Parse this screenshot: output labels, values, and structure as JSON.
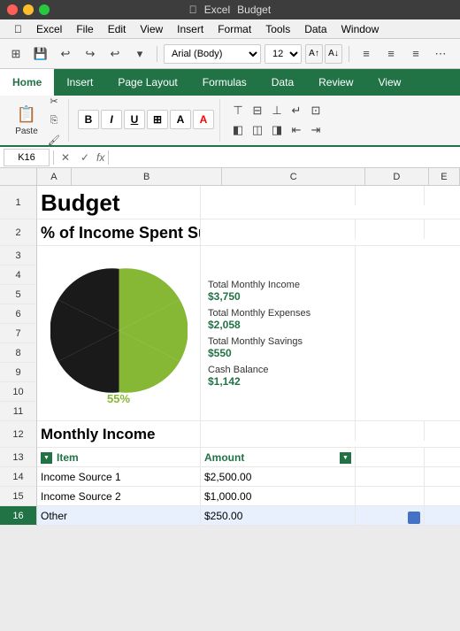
{
  "titleBar": {
    "appName": "Excel",
    "fileName": "Budget"
  },
  "menuBar": {
    "items": [
      "Apple",
      "Excel",
      "File",
      "Edit",
      "View",
      "Insert",
      "Format",
      "Tools",
      "Data",
      "Window"
    ]
  },
  "ribbon": {
    "tabs": [
      "Home",
      "Insert",
      "Page Layout",
      "Formulas",
      "Data",
      "Review",
      "View"
    ],
    "activeTab": "Home"
  },
  "formulaBar": {
    "cellRef": "K16",
    "formula": ""
  },
  "columnHeaders": [
    "A",
    "B",
    "C",
    "D",
    "E"
  ],
  "rows": {
    "r1": {
      "rowNum": "1",
      "b": "Budget"
    },
    "r2": {
      "rowNum": "2",
      "b": "% of Income Spent Summary"
    },
    "r3": {
      "rowNum": "3"
    },
    "r4": {
      "rowNum": "4"
    },
    "r5": {
      "rowNum": "5"
    },
    "r6": {
      "rowNum": "6"
    },
    "r7": {
      "rowNum": "7"
    },
    "r8": {
      "rowNum": "8"
    },
    "r9": {
      "rowNum": "9"
    },
    "r10": {
      "rowNum": "10"
    },
    "r11": {
      "rowNum": "11"
    },
    "r12": {
      "rowNum": "12",
      "b": "Monthly Income"
    },
    "r13": {
      "rowNum": "13",
      "b": "Item",
      "c": "Amount"
    },
    "r14": {
      "rowNum": "14",
      "b": "Income Source 1",
      "c": "$2,500.00"
    },
    "r15": {
      "rowNum": "15",
      "b": "Income Source 2",
      "c": "$1,000.00"
    },
    "r16": {
      "rowNum": "16",
      "b": "Other",
      "c": "$250.00"
    }
  },
  "summary": {
    "income": {
      "label": "Total Monthly Income",
      "value": "$3,750"
    },
    "expenses": {
      "label": "Total Monthly Expenses",
      "value": "$2,058"
    },
    "savings": {
      "label": "Total Monthly Savings",
      "value": "$550"
    },
    "cashBalance": {
      "label": "Cash Balance",
      "value": "$1,142"
    }
  },
  "chart": {
    "percentage": "55%",
    "greenPercent": 55,
    "blackPercent": 45
  },
  "toolbar": {
    "pasteLabel": "Paste",
    "fontFamily": "Arial (Body)",
    "fontSize": "12",
    "boldLabel": "B",
    "italicLabel": "I",
    "underlineLabel": "U"
  }
}
